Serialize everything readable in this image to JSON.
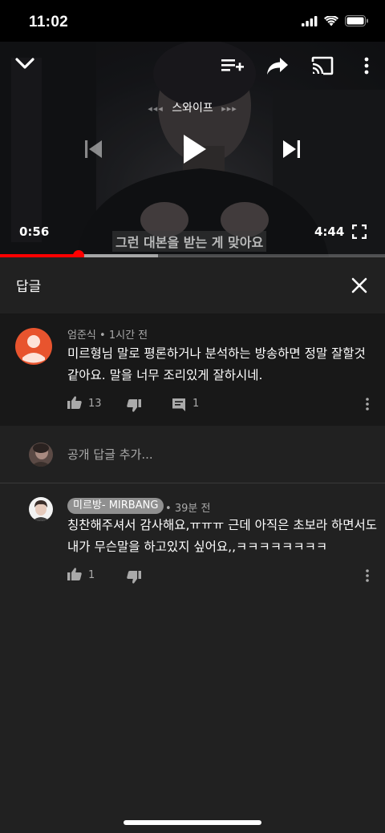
{
  "status_bar": {
    "time": "11:02"
  },
  "player": {
    "swipe_label": "스와이프",
    "swipe_left_arrows": "◂◂◂",
    "swipe_right_arrows": "▸▸▸",
    "current_time": "0:56",
    "total_time": "4:44",
    "subtitle": "그런 대본을 받는 게 맞아요",
    "progress_fraction": 0.205,
    "buffer_fraction": 0.41
  },
  "replies_panel": {
    "title": "답글"
  },
  "parent_comment": {
    "author": "엄준식",
    "time": "1시간 전",
    "text_line1": "미르형님 말로 평론하거나 분석하는 방송하면 정말 잘할것",
    "text_line2": "같아요. 말을 너무 조리있게 잘하시네.",
    "likes": "13",
    "replies": "1",
    "avatar_color": "#e8542e"
  },
  "add_reply": {
    "placeholder": "공개 답글 추가..."
  },
  "reply": {
    "author": "미르방- MIRBANG",
    "time": "39분 전",
    "text_line1": "칭찬해주셔서 감사해요,ㅠㅠㅠ 근데 아직은 초보라 하면서도",
    "text_line2": "내가 무슨말을 하고있지 싶어요,,ㅋㅋㅋㅋㅋㅋㅋㅋ",
    "likes": "1"
  },
  "colors": {
    "accent_red": "#ff0000",
    "background": "#212121",
    "surface": "#181818"
  }
}
